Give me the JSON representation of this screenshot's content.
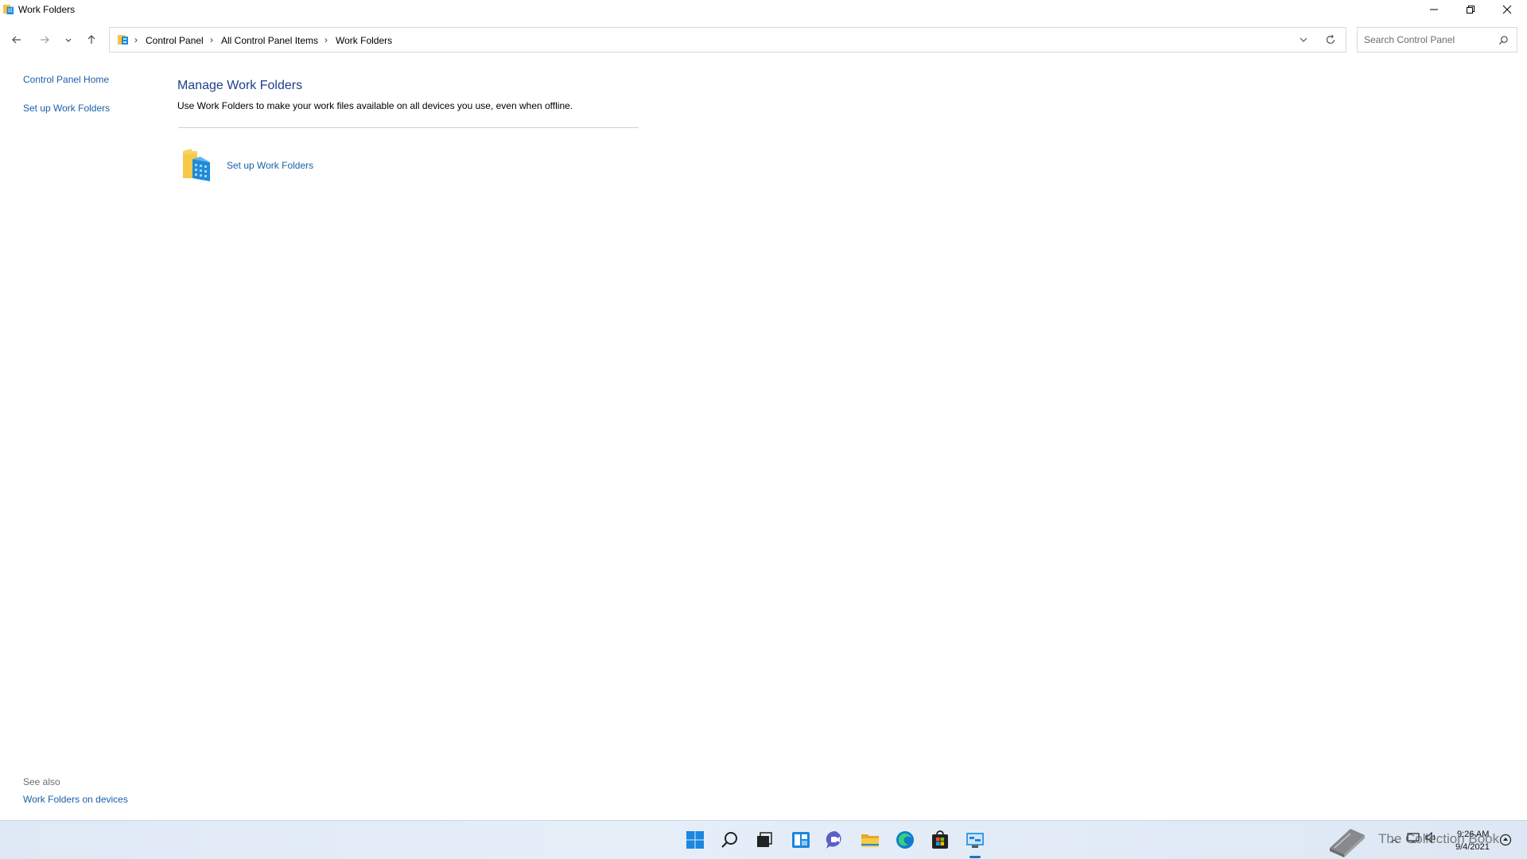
{
  "window": {
    "title": "Work Folders",
    "controls": {
      "minimize": "minimize",
      "restore": "restore",
      "close": "close"
    }
  },
  "address": {
    "breadcrumbs": [
      "Control Panel",
      "All Control Panel Items",
      "Work Folders"
    ],
    "search_placeholder": "Search Control Panel"
  },
  "left_pane": {
    "links": [
      "Control Panel Home",
      "Set up Work Folders"
    ],
    "see_also_heading": "See also",
    "see_also_links": [
      "Work Folders on devices"
    ]
  },
  "main": {
    "title": "Manage Work Folders",
    "description": "Use Work Folders to make your work files available on all devices you use, even when offline.",
    "task_link": "Set up Work Folders"
  },
  "taskbar": {
    "icons": [
      "windows-start-icon",
      "search-icon",
      "task-view-icon",
      "widgets-icon",
      "chat-icon",
      "file-explorer-icon",
      "edge-icon",
      "store-icon",
      "control-panel-icon"
    ],
    "clock_time": "9:26 AM",
    "clock_date": "9/4/2021"
  },
  "watermark": {
    "text": "The Collection Book"
  },
  "colors": {
    "link": "#1a5fa8",
    "heading": "#1e3f8a",
    "taskbar_bg": "#e1ebf6",
    "accent": "#1a73c9"
  }
}
